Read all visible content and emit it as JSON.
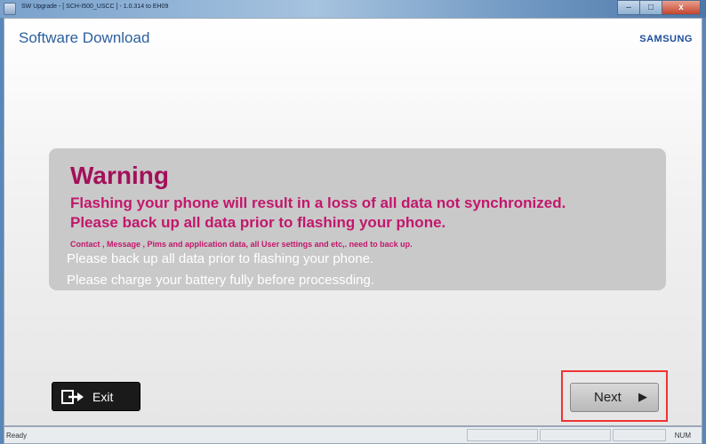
{
  "window": {
    "title": "SW Upgrade - [ SCH-I500_USCC ] - 1.0.314 to EH09",
    "controls": {
      "minimize": "–",
      "maximize": "□",
      "close": "x"
    }
  },
  "header": {
    "title": "Software Download",
    "logo": "SAMSUNG"
  },
  "warning": {
    "heading": "Warning",
    "line1": "Flashing your phone will result in a loss of all data not synchronized.",
    "line2": "Please back up all data prior to flashing your phone.",
    "small": "Contact , Message , Pims and application data, all User settings and etc,. need to back up.",
    "info1": "Please back up all data prior to flashing your phone.",
    "info2": "Please charge your battery fully before processding."
  },
  "buttons": {
    "exit": "Exit",
    "next": "Next"
  },
  "status": {
    "left": "Ready",
    "right": "NUM"
  },
  "icons": {
    "exit": "exit-arrow-icon",
    "next": "play-arrow-icon"
  },
  "colors": {
    "title": "#2c5f9d",
    "warning": "#c2176c",
    "panel": "#c9c9c9",
    "highlight": "#ee3333"
  }
}
